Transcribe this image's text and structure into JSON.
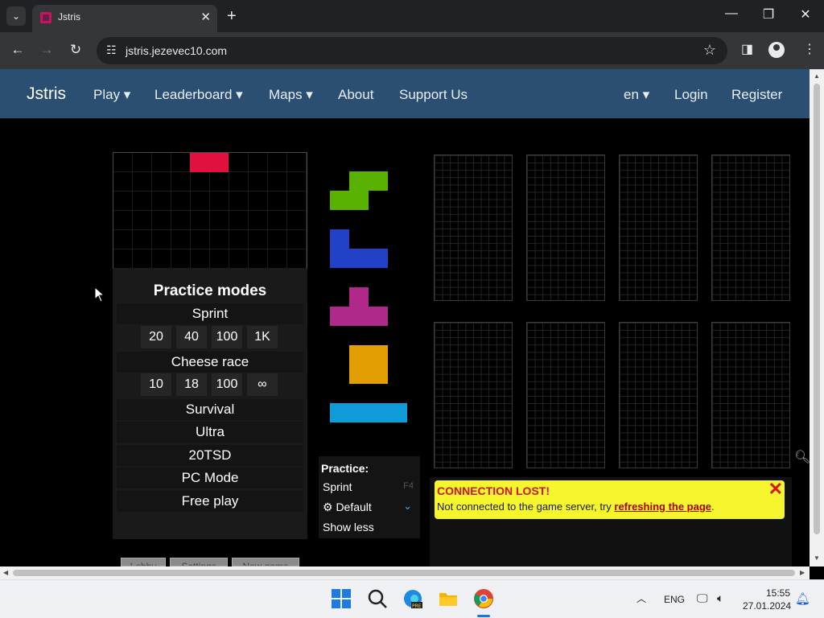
{
  "browser": {
    "tab_title": "Jstris",
    "url": "jstris.jezevec10.com",
    "icons": [
      "tab-search-icon",
      "close-icon",
      "plus-icon",
      "minimize-icon",
      "restore-icon",
      "back-icon",
      "forward-icon",
      "reload-icon",
      "site-info-icon",
      "star-icon",
      "sidebar-icon",
      "profile-icon",
      "kebab-menu-icon"
    ]
  },
  "site_nav": {
    "brand": "Jstris",
    "play": "Play ▾",
    "leaderboard": "Leaderboard ▾",
    "maps": "Maps ▾",
    "about": "About",
    "support": "Support Us",
    "lang": "en ▾",
    "login": "Login",
    "register": "Register"
  },
  "practice_menu": {
    "title": "Practice modes",
    "sprint": "Sprint",
    "sprint_options": [
      "20",
      "40",
      "100",
      "1K"
    ],
    "cheese": "Cheese race",
    "cheese_options": [
      "10",
      "18",
      "100",
      "∞"
    ],
    "survival": "Survival",
    "ultra": "Ultra",
    "tsd": "20TSD",
    "pc": "PC Mode",
    "free": "Free play"
  },
  "queue": {
    "pieces": [
      "S",
      "J",
      "T",
      "O",
      "I"
    ],
    "colors": {
      "S": "#59b101",
      "J": "#2141c6",
      "T": "#af298a",
      "O": "#e39f02",
      "I": "#0f9bd7"
    }
  },
  "current_piece": {
    "color": "#e0103f"
  },
  "practice_panel": {
    "heading": "Practice:",
    "mode": "Sprint",
    "key": "F4",
    "default_label": "⚙ Default",
    "show_less": "Show less"
  },
  "alert": {
    "title": "CONNECTION LOST!",
    "message": "Not connected to the game server, try ",
    "link": "refreshing the page",
    "suffix": ".",
    "close": "✕"
  },
  "lobby_buttons": [
    "Lobby",
    "Settings",
    "New game"
  ],
  "taskbar": {
    "lang": "ENG",
    "time": "15:55",
    "date": "27.01.2024",
    "icons": [
      "windows-start-icon",
      "search-icon",
      "edge-icon",
      "file-explorer-icon",
      "chrome-icon",
      "chevron-up-icon",
      "network-icon",
      "volume-icon",
      "bell-icon"
    ]
  }
}
